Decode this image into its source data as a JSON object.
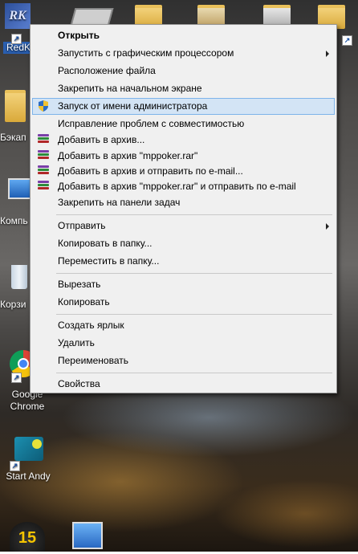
{
  "desktop_icons": {
    "redk": {
      "label": "RedK"
    },
    "backup": {
      "label": "Бэкап"
    },
    "computer": {
      "label": "Компь"
    },
    "recycle": {
      "label": "Корзи"
    },
    "chrome": {
      "label_line1": "Google",
      "label_line2": "Chrome"
    },
    "andy": {
      "label": "Start Andy"
    }
  },
  "context_menu": {
    "items": [
      {
        "label": "Открыть",
        "bold": true
      },
      {
        "label": "Запустить с графическим процессором",
        "submenu": true
      },
      {
        "label": "Расположение файла"
      },
      {
        "label": "Закрепить на начальном экране"
      },
      {
        "label": "Запуск от имени администратора",
        "icon": "shield-icon",
        "highlighted": true
      },
      {
        "label": "Исправление проблем с совместимостью"
      },
      {
        "label": "Добавить в архив...",
        "icon": "winrar-icon"
      },
      {
        "label": "Добавить в архив \"mppoker.rar\"",
        "icon": "winrar-icon"
      },
      {
        "label": "Добавить в архив и отправить по e-mail...",
        "icon": "winrar-icon"
      },
      {
        "label": "Добавить в архив \"mppoker.rar\" и отправить по e-mail",
        "icon": "winrar-icon"
      },
      {
        "label": "Закрепить на панели задач"
      },
      {
        "label": "Отправить",
        "submenu": true
      },
      {
        "label": "Копировать в папку..."
      },
      {
        "label": "Переместить в папку..."
      },
      {
        "label": "Вырезать"
      },
      {
        "label": "Копировать"
      },
      {
        "label": "Создать ярлык"
      },
      {
        "label": "Удалить"
      },
      {
        "label": "Переименовать"
      },
      {
        "label": "Свойства"
      }
    ]
  },
  "colors": {
    "highlight_bg": "#d3e4f5",
    "highlight_border": "#7eb4ea",
    "menu_bg": "#f0f0f0"
  }
}
